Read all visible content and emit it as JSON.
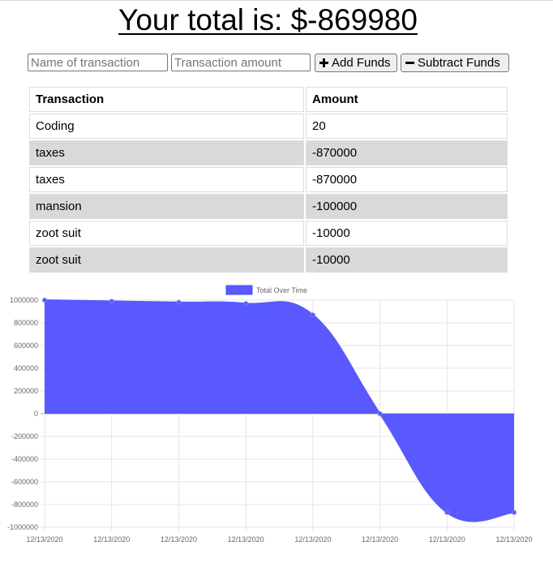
{
  "header": {
    "total_text": "Your total is: $-869980"
  },
  "form": {
    "name_placeholder": "Name of transaction",
    "amount_placeholder": "Transaction amount",
    "add_label": "Add Funds",
    "subtract_label": "Subtract Funds"
  },
  "table": {
    "headers": [
      "Transaction",
      "Amount"
    ],
    "rows": [
      [
        "Coding",
        "20"
      ],
      [
        "taxes",
        "-870000"
      ],
      [
        "taxes",
        "-870000"
      ],
      [
        "mansion",
        "-100000"
      ],
      [
        "zoot suit",
        "-10000"
      ],
      [
        "zoot suit",
        "-10000"
      ]
    ]
  },
  "chart_data": {
    "type": "area",
    "legend": "Total Over Time",
    "legend_position": "top",
    "x": [
      "12/13/2020",
      "12/13/2020",
      "12/13/2020",
      "12/13/2020",
      "12/13/2020",
      "12/13/2020",
      "12/13/2020",
      "12/13/2020"
    ],
    "series": [
      {
        "name": "Total Over Time",
        "values": [
          1000000,
          990000,
          980000,
          970000,
          870000,
          0,
          -870000,
          -869980
        ]
      }
    ],
    "ylim": [
      -1000000,
      1000000
    ],
    "yticks": [
      1000000,
      800000,
      600000,
      400000,
      200000,
      0,
      -200000,
      -400000,
      -600000,
      -800000,
      -1000000
    ],
    "grid": true,
    "fill_color": "#5959ff",
    "line_color": "#5959ff"
  }
}
